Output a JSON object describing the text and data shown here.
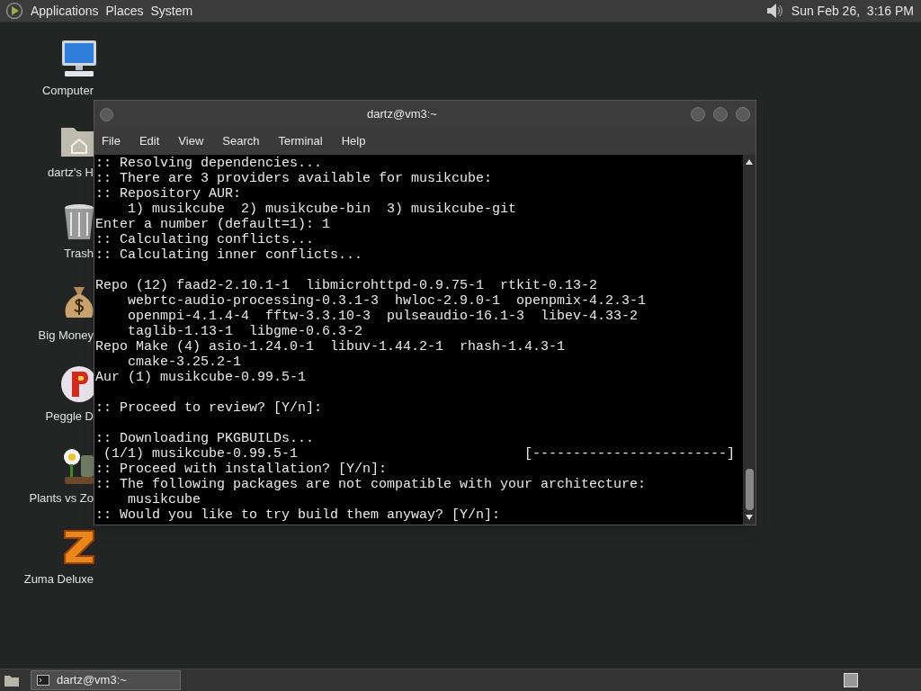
{
  "top_panel": {
    "menus": [
      "Applications",
      "Places",
      "System"
    ],
    "clock": "Sun Feb 26,  3:16 PM"
  },
  "desktop_icons": [
    {
      "kind": "computer",
      "label": "Computer"
    },
    {
      "kind": "home",
      "label": "dartz's H"
    },
    {
      "kind": "trash",
      "label": "Trash"
    },
    {
      "kind": "moneybag",
      "label": "Big Money"
    },
    {
      "kind": "peggle",
      "label": "Peggle D"
    },
    {
      "kind": "plants",
      "label": "Plants vs Zo"
    },
    {
      "kind": "zuma",
      "label": "Zuma Deluxe"
    }
  ],
  "window": {
    "title": "dartz@vm3:~",
    "menus": [
      "File",
      "Edit",
      "View",
      "Search",
      "Terminal",
      "Help"
    ],
    "terminal_blocks": [
      [
        ":: Resolving dependencies...",
        ":: There are 3 providers available for musikcube:",
        ":: Repository AUR:",
        "    1) musikcube  2) musikcube-bin  3) musikcube-git",
        "Enter a number (default=1): 1",
        ":: Calculating conflicts...",
        ":: Calculating inner conflicts..."
      ],
      [
        "Repo (12) faad2-2.10.1-1  libmicrohttpd-0.9.75-1  rtkit-0.13-2",
        "    webrtc-audio-processing-0.3.1-3  hwloc-2.9.0-1  openpmix-4.2.3-1",
        "    openmpi-4.1.4-4  fftw-3.3.10-3  pulseaudio-16.1-3  libev-4.33-2",
        "    taglib-1.13-1  libgme-0.6.3-2",
        "Repo Make (4) asio-1.24.0-1  libuv-1.44.2-1  rhash-1.4.3-1",
        "    cmake-3.25.2-1",
        "Aur (1) musikcube-0.99.5-1"
      ],
      [
        ":: Proceed to review? [Y/n]:"
      ],
      [
        ":: Downloading PKGBUILDs...",
        " (1/1) musikcube-0.99.5-1                            [------------------------]",
        ":: Proceed with installation? [Y/n]:",
        ":: The following packages are not compatible with your architecture:",
        "    musikcube",
        ":: Would you like to try build them anyway? [Y/n]:"
      ]
    ]
  },
  "taskbar": {
    "tasks": [
      {
        "label": "dartz@vm3:~",
        "selected": true
      }
    ]
  }
}
